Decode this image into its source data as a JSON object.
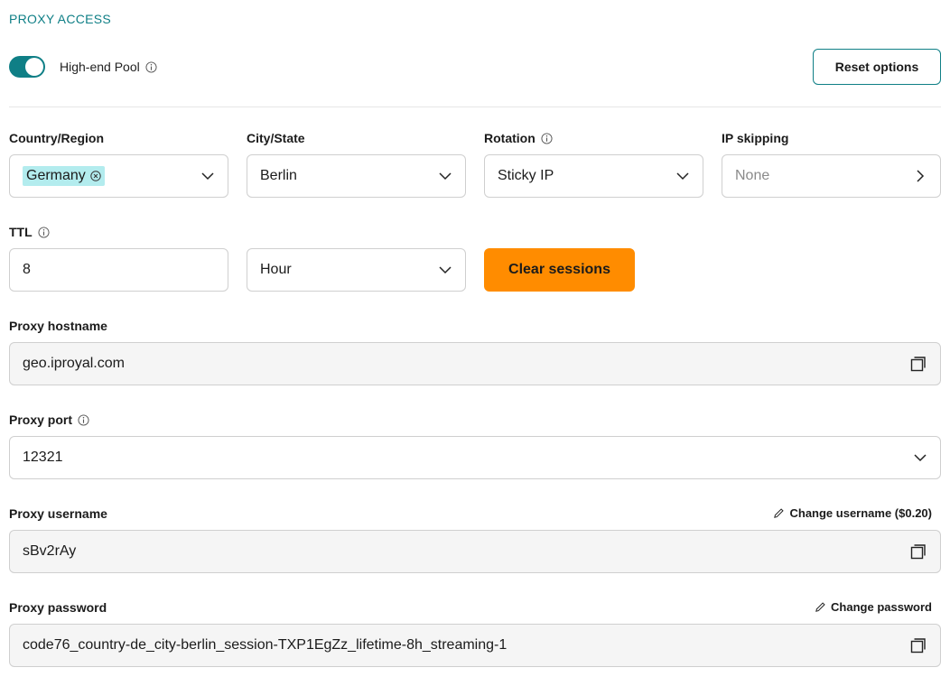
{
  "section_title": "PROXY ACCESS",
  "pool": {
    "label": "High-end Pool",
    "enabled": true
  },
  "reset_button": "Reset options",
  "filters": {
    "country": {
      "label": "Country/Region",
      "selected": "Germany"
    },
    "city": {
      "label": "City/State",
      "selected": "Berlin"
    },
    "rotation": {
      "label": "Rotation",
      "selected": "Sticky IP"
    },
    "ip_skipping": {
      "label": "IP skipping",
      "value": "None"
    }
  },
  "ttl": {
    "label": "TTL",
    "value": "8",
    "unit": "Hour"
  },
  "clear_button": "Clear sessions",
  "hostname": {
    "label": "Proxy hostname",
    "value": "geo.iproyal.com"
  },
  "port": {
    "label": "Proxy port",
    "value": "12321"
  },
  "username": {
    "label": "Proxy username",
    "value": "sBv2rAy",
    "change_label": "Change username ($0.20)"
  },
  "password": {
    "label": "Proxy password",
    "value": "code76_country-de_city-berlin_session-TXP1EgZz_lifetime-8h_streaming-1",
    "change_label": "Change password"
  },
  "colors": {
    "accent": "#0f7f86",
    "chip_bg": "#b3ecee",
    "clear_button": "#ff8c00",
    "readonly_bg": "#f5f5f5"
  },
  "icons": [
    "info-icon",
    "chevron-down-icon",
    "chevron-right-icon",
    "clear-chip-icon",
    "copy-icon",
    "pencil-icon"
  ]
}
